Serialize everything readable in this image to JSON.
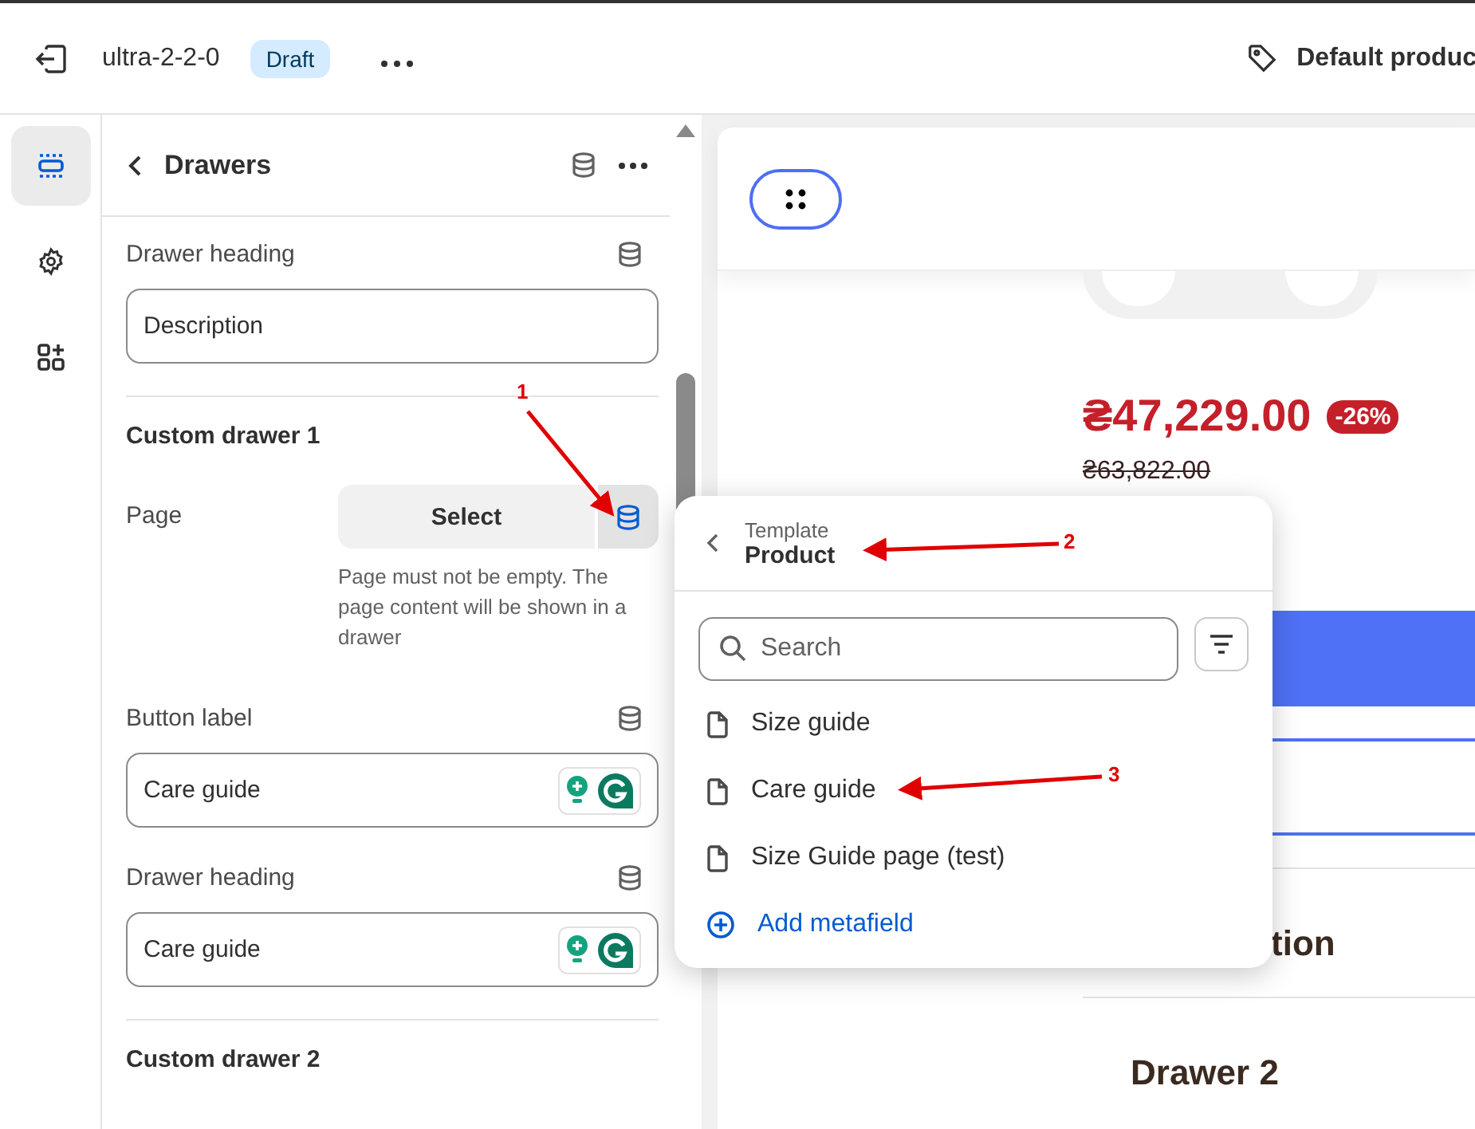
{
  "topbar": {
    "theme_name": "ultra-2-2-0",
    "status": "Draft",
    "template": "Default produc"
  },
  "rail": [
    {
      "kind": "sections",
      "selected": true
    },
    {
      "kind": "settings",
      "selected": false
    },
    {
      "kind": "apps",
      "selected": false
    }
  ],
  "panel": {
    "title": "Drawers",
    "fields": [
      {
        "kind": "text",
        "label": "Drawer heading",
        "value": "Description",
        "assist": false
      },
      {
        "kind": "heading",
        "text": "Custom drawer 1"
      },
      {
        "kind": "page",
        "label": "Page",
        "button": "Select",
        "help": "Page must not be empty. The page content will be shown in a drawer",
        "source_active": true
      },
      {
        "kind": "text",
        "label": "Button label",
        "value": "Care guide",
        "assist": true
      },
      {
        "kind": "text",
        "label": "Drawer heading",
        "value": "Care guide",
        "assist": true
      },
      {
        "kind": "heading",
        "text": "Custom drawer 2"
      }
    ]
  },
  "popover": {
    "caption": "Template",
    "title": "Product",
    "search_placeholder": "Search",
    "items": [
      "Size guide",
      "Care guide",
      "Size Guide page (test)"
    ],
    "add": "Add metafield"
  },
  "preview": {
    "price": "₴47,229.00",
    "discount": "-26%",
    "compare_price": "₴63,822.00",
    "heading": "tion",
    "drawer": "Drawer 2"
  },
  "annotations": [
    "1",
    "2",
    "3"
  ]
}
